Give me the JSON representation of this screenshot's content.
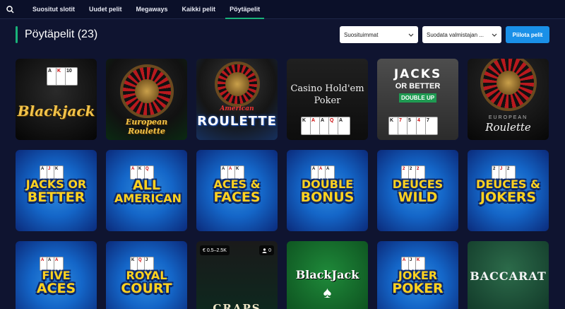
{
  "nav": {
    "items": [
      "Suositut slotit",
      "Uudet pelit",
      "Megaways",
      "Kaikki pelit",
      "Pöytäpelit"
    ],
    "active_index": 4
  },
  "header": {
    "title": "Pöytäpelit (23)"
  },
  "controls": {
    "sort_select": "Suosituimmat",
    "provider_filter": "Suodata valmistajan ...",
    "hide_button": "Piilota pelit"
  },
  "games": {
    "blackjack": {
      "title": "Blackjack"
    },
    "european_roulette": {
      "title": "European Roulette"
    },
    "american_roulette": {
      "sub": "American",
      "title": "ROULETTE"
    },
    "holdem": {
      "line1": "Casino Hold'em",
      "line2": "Poker"
    },
    "jacks_double": {
      "title": "JACKS",
      "sub": "OR BETTER",
      "tag": "DOUBLE UP"
    },
    "eur_roulette2": {
      "sub": "EUROPEAN",
      "title": "Roulette"
    },
    "jacks_better": {
      "l1": "JACKS OR",
      "l2": "BETTER"
    },
    "all_american": {
      "l1": "ALL",
      "l2": "AMERICAN"
    },
    "aces_faces": {
      "l1": "ACES &",
      "l2": "FACES"
    },
    "double_bonus": {
      "l1": "DOUBLE",
      "l2": "BONUS"
    },
    "deuces_wild": {
      "l1": "DEUCES",
      "l2": "WILD"
    },
    "deuces_jokers": {
      "l1": "DEUCES &",
      "l2": "JOKERS"
    },
    "five_aces": {
      "l1": "FIVE",
      "l2": "ACES"
    },
    "royal_court": {
      "l1": "ROYAL",
      "l2": "COURT"
    },
    "craps": {
      "title": "CRAPS",
      "stake": "€ 0.5–2.5K",
      "players": "0"
    },
    "blackjack2": {
      "title": "BlackJack"
    },
    "joker_poker": {
      "l1": "JOKER",
      "l2": "POKER"
    },
    "baccarat": {
      "title": "BACCARAT"
    }
  },
  "colors": {
    "background": "#0f1430",
    "accent_green": "#19b37a",
    "button_blue": "#1a90e8"
  }
}
